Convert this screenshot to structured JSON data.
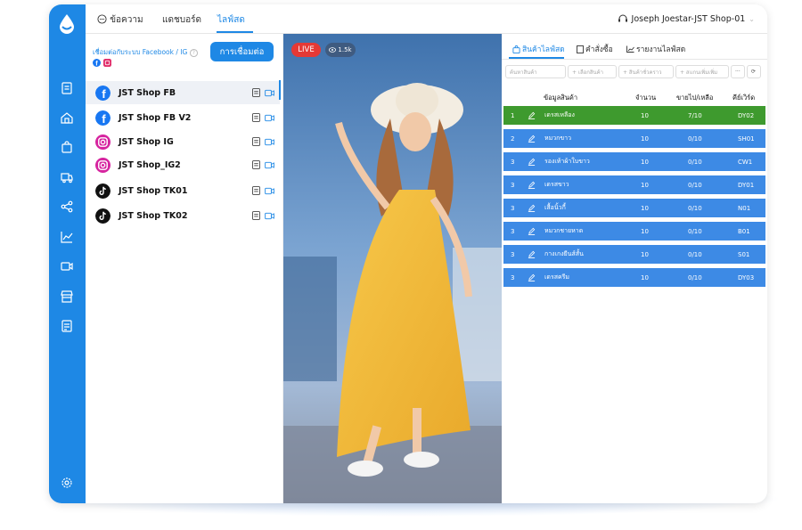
{
  "colors": {
    "primary": "#1e88e5",
    "row_active": "#3e9a2e",
    "row": "#3d8ae5",
    "live": "#e53935"
  },
  "nav": {
    "tabs": [
      "ข้อความ",
      "แดชบอร์ด",
      "ไลฟ์สด"
    ],
    "active": 2,
    "user": "Joseph Joestar-JST Shop-01"
  },
  "sidebar": {
    "icons": [
      "document-icon",
      "home-icon",
      "bag-icon",
      "truck-icon",
      "share-icon",
      "chart-icon",
      "video-icon",
      "store-icon",
      "report-icon"
    ],
    "settings": "gear-icon"
  },
  "connect": {
    "text": "เชื่อมต่อกับระบบ Facebook / IG",
    "button": "การเชื่อมต่อ"
  },
  "shops": [
    {
      "name": "JST Shop FB",
      "platform": "facebook",
      "selected": true
    },
    {
      "name": "JST Shop FB V2",
      "platform": "facebook"
    },
    {
      "name": "JST Shop IG",
      "platform": "instagram"
    },
    {
      "name": "JST Shop_IG2",
      "platform": "instagram"
    },
    {
      "name": "JST Shop TK01",
      "platform": "tiktok"
    },
    {
      "name": "JST Shop TK02",
      "platform": "tiktok"
    }
  ],
  "video": {
    "live": "LIVE",
    "views": "1.5k"
  },
  "right": {
    "tabs": [
      "สินค้าไลฟ์สด",
      "คำสั่งซื้อ",
      "รายงานไลฟ์สด"
    ],
    "filters": [
      "ค้นหาสินค้า",
      "+ เลือกสินค้า",
      "+ สินค้าชั่วคราว",
      "+ สแกนเพิ่มเพิ่ม",
      "···"
    ],
    "headers": [
      "ข้อมูลสินค้า",
      "จำนวน",
      "ขายไป/เหลือ",
      "คีย์เวิร์ด"
    ],
    "rows": [
      [
        "1",
        "เดรสเหลือง",
        "10",
        "7/10",
        "DY02"
      ],
      [
        "2",
        "หมวกขาว",
        "10",
        "0/10",
        "SH01"
      ],
      [
        "3",
        "รองเท้าผ้าใบขาว",
        "10",
        "0/10",
        "CW1"
      ],
      [
        "3",
        "เดรสขาว",
        "10",
        "0/10",
        "DY01"
      ],
      [
        "3",
        "เสื้อนิ้วกี้",
        "10",
        "0/10",
        "N01"
      ],
      [
        "3",
        "หมวกชายหาด",
        "10",
        "0/10",
        "B01"
      ],
      [
        "3",
        "กางเกงยีนส์สั้น",
        "10",
        "0/10",
        "S01"
      ],
      [
        "3",
        "เดรสครีม",
        "10",
        "0/10",
        "DY03"
      ]
    ]
  }
}
